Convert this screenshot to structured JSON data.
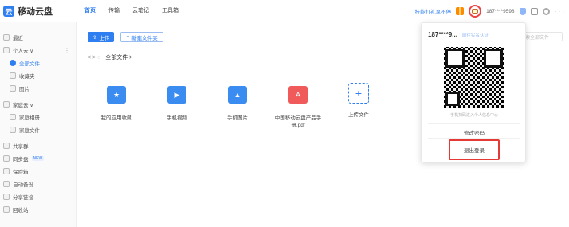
{
  "app": {
    "logo_text": "移动云盘",
    "logo_glyph": "云"
  },
  "nav": {
    "items": [
      {
        "label": "首页",
        "active": true
      },
      {
        "label": "传输",
        "active": false
      },
      {
        "label": "云笔记",
        "active": false
      },
      {
        "label": "工具箱",
        "active": false
      }
    ]
  },
  "topright": {
    "promo_text": "技能打礼享不停",
    "phone": "187****9598",
    "dots": "· · ·"
  },
  "sidebar": {
    "items": [
      {
        "label": "最近"
      },
      {
        "label": "个人云 ∨",
        "more": "⋮"
      },
      {
        "label": "全部文件",
        "active": true
      },
      {
        "label": "收藏夹"
      },
      {
        "label": "图片"
      },
      {
        "label": "家庭云 ∨"
      },
      {
        "label": "家庭相册"
      },
      {
        "label": "家庭文件"
      },
      {
        "label": "共享群"
      },
      {
        "label": "同步盘",
        "tag": "NEW"
      },
      {
        "label": "保险箱"
      },
      {
        "label": "自动备份"
      },
      {
        "label": "分享链接"
      },
      {
        "label": "回收站"
      }
    ]
  },
  "toolbar": {
    "upload_label": "上传",
    "new_folder_label": "新建文件夹"
  },
  "breadcrumb": {
    "nav_glyphs": "< >  ◌",
    "path": "全部文件 >"
  },
  "search": {
    "placeholder": "搜索全部文件"
  },
  "files": [
    {
      "name": "我的应用收藏",
      "type": "folder",
      "glyph": "★"
    },
    {
      "name": "手机视频",
      "type": "folder",
      "glyph": "▶"
    },
    {
      "name": "手机图片",
      "type": "folder",
      "glyph": "▲"
    },
    {
      "name": "中国移动云盘产品手册.pdf",
      "type": "pdf",
      "glyph": "A"
    },
    {
      "name": "上传文件",
      "type": "upload",
      "glyph": "+"
    }
  ],
  "popup": {
    "user": "187****9...",
    "verify": "前往实名认证",
    "qr_hint": "手机扫码进入个人信息中心",
    "change_password": "修改密码",
    "logout": "退出登录"
  },
  "colors": {
    "accent": "#2f7ff0",
    "highlight": "#e53935",
    "pdf": "#f05a5a"
  }
}
